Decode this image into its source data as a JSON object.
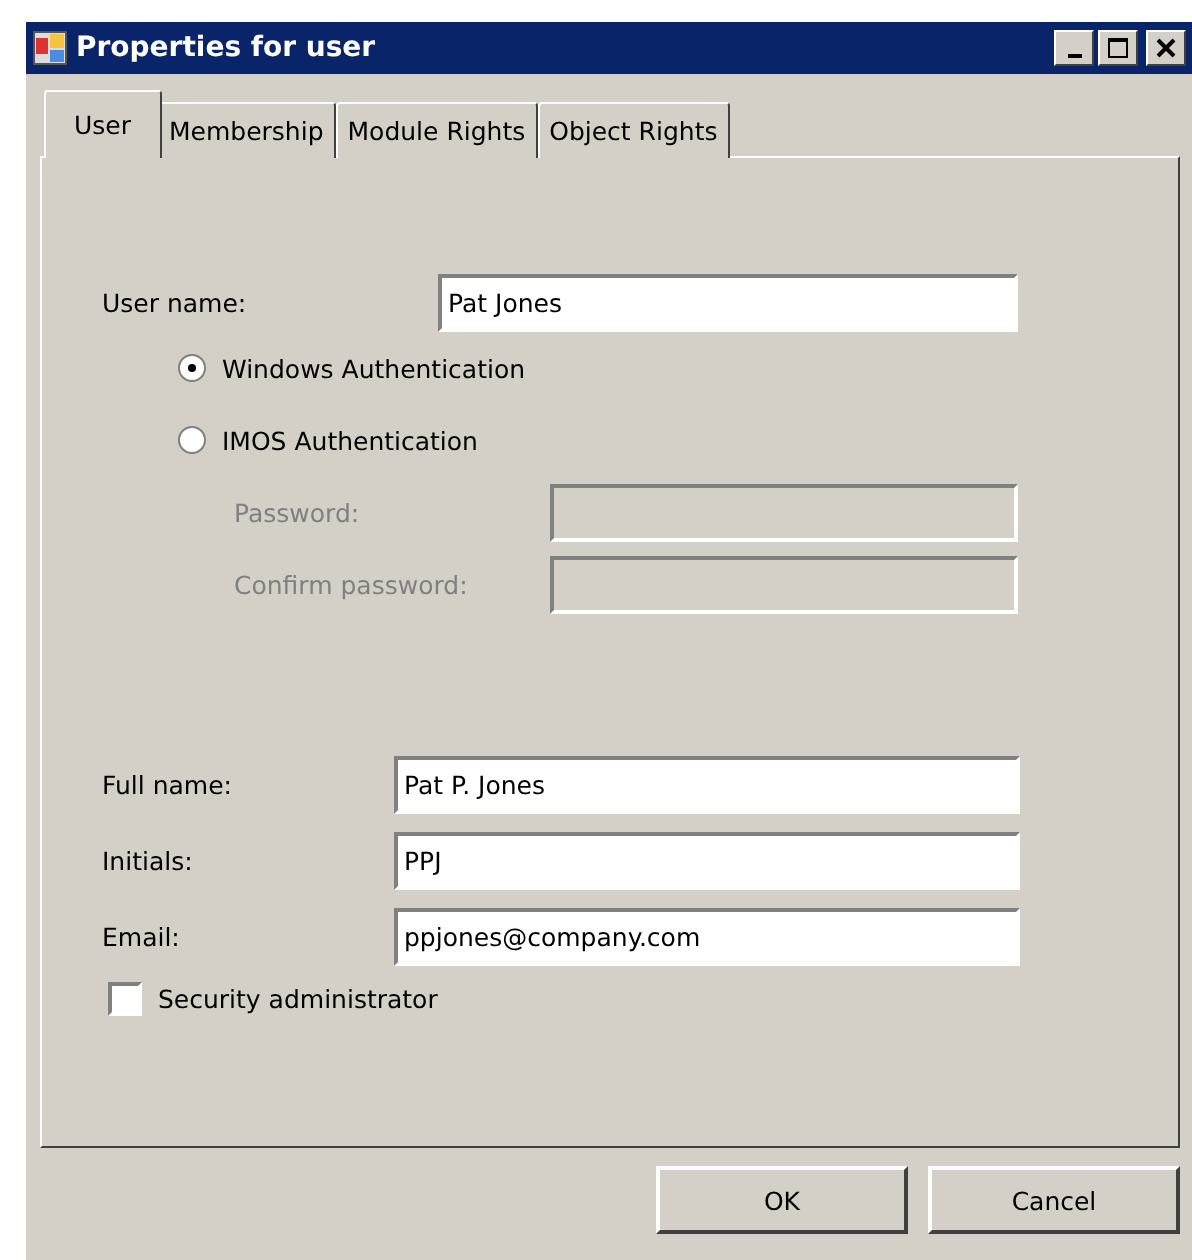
{
  "window": {
    "title": "Properties for user"
  },
  "tabs": [
    {
      "label": "User",
      "selected": true
    },
    {
      "label": "Membership",
      "selected": false
    },
    {
      "label": "Module Rights",
      "selected": false
    },
    {
      "label": "Object Rights",
      "selected": false
    }
  ],
  "user_name": {
    "label": "User name:",
    "value": "Pat Jones"
  },
  "authentication": [
    {
      "label": "Windows Authentication",
      "selected": true
    },
    {
      "label": "IMOS Authentication",
      "selected": false
    }
  ],
  "password_fields": [
    {
      "label": "Password:",
      "disabled": true
    },
    {
      "label": "Confirm password:",
      "disabled": true
    }
  ],
  "details": [
    {
      "label": "Full name:",
      "value": "Pat P. Jones"
    },
    {
      "label": "Initials:",
      "value": "PPJ"
    },
    {
      "label": "Email:",
      "value": "ppjones@company.com"
    }
  ],
  "security_administrator": {
    "label": "Security administrator",
    "checked": false
  },
  "buttons": [
    "OK",
    "Cancel"
  ]
}
